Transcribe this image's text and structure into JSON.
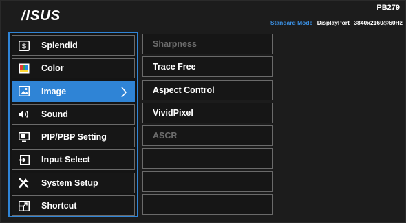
{
  "header": {
    "brand": "/ISUS",
    "model": "PB279",
    "mode": "Standard Mode",
    "port": "DisplayPort",
    "resolution": "3840x2160@60Hz"
  },
  "menu": {
    "items": [
      {
        "label": "Splendid",
        "icon": "splendid-icon"
      },
      {
        "label": "Color",
        "icon": "color-icon"
      },
      {
        "label": "Image",
        "icon": "image-icon",
        "active": true
      },
      {
        "label": "Sound",
        "icon": "speaker-icon"
      },
      {
        "label": "PIP/PBP Setting",
        "icon": "pip-icon"
      },
      {
        "label": "Input Select",
        "icon": "input-icon"
      },
      {
        "label": "System Setup",
        "icon": "tools-icon"
      },
      {
        "label": "Shortcut",
        "icon": "shortcut-icon"
      }
    ]
  },
  "submenu": {
    "items": [
      {
        "label": "Sharpness",
        "enabled": false
      },
      {
        "label": "Trace Free",
        "enabled": true
      },
      {
        "label": "Aspect Control",
        "enabled": true
      },
      {
        "label": "VividPixel",
        "enabled": true
      },
      {
        "label": "ASCR",
        "enabled": false
      },
      {
        "label": "",
        "enabled": false
      },
      {
        "label": "",
        "enabled": false
      },
      {
        "label": "",
        "enabled": false
      }
    ]
  },
  "colors": {
    "accent": "#2f84d6",
    "background": "#1c1c1c",
    "disabled_text": "#6c6c6c"
  }
}
